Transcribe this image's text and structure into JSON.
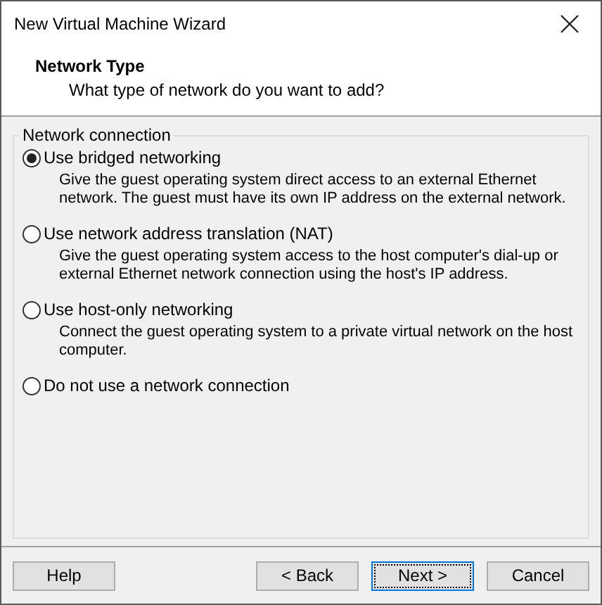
{
  "window": {
    "title": "New Virtual Machine Wizard"
  },
  "header": {
    "title": "Network Type",
    "subtitle": "What type of network do you want to add?"
  },
  "group": {
    "label": "Network connection",
    "options": [
      {
        "label": "Use bridged networking",
        "description": "Give the guest operating system direct access to an external Ethernet network. The guest must have its own IP address on the external network.",
        "selected": true
      },
      {
        "label": "Use network address translation (NAT)",
        "description": "Give the guest operating system access to the host computer's dial-up or external Ethernet network connection using the host's IP address.",
        "selected": false
      },
      {
        "label": "Use host-only networking",
        "description": "Connect the guest operating system to a private virtual network on the host computer.",
        "selected": false
      },
      {
        "label": "Do not use a network connection",
        "selected": false
      }
    ]
  },
  "buttons": [
    {
      "label": "Help",
      "kind": "left",
      "default": false
    },
    {
      "label": "< Back",
      "kind": "right",
      "default": false
    },
    {
      "label": "Next >",
      "kind": "right",
      "default": true
    },
    {
      "label": "Cancel",
      "kind": "right",
      "default": false
    }
  ]
}
